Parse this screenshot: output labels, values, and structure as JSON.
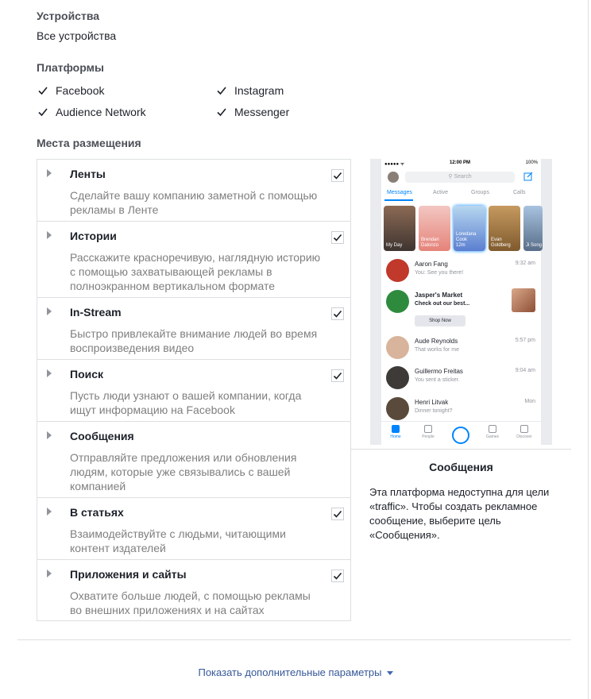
{
  "devices": {
    "title": "Устройства",
    "value": "Все устройства"
  },
  "platforms": {
    "title": "Платформы",
    "items": [
      {
        "label": "Facebook",
        "checked": true
      },
      {
        "label": "Instagram",
        "checked": true
      },
      {
        "label": "Audience Network",
        "checked": true
      },
      {
        "label": "Messenger",
        "checked": true
      }
    ]
  },
  "placements": {
    "title": "Места размещения",
    "items": [
      {
        "title": "Ленты",
        "desc": "Сделайте вашу компанию заметной с помощью рекламы в Ленте",
        "checked": true
      },
      {
        "title": "Истории",
        "desc": "Расскажите красноречивую, наглядную историю с помощью захватывающей рекламы в полноэкранном вертикальном формате",
        "checked": true
      },
      {
        "title": "In-Stream",
        "desc": "Быстро привлекайте внимание людей во время воспроизведения видео",
        "checked": true
      },
      {
        "title": "Поиск",
        "desc": "Пусть люди узнают о вашей компании, когда ищут информацию на Facebook",
        "checked": true
      },
      {
        "title": "Сообщения",
        "desc": "Отправляйте предложения или обновления людям, которые уже связывались с вашей компанией",
        "checked": false
      },
      {
        "title": "В статьях",
        "desc": "Взаимодействуйте с людьми, читающими контент издателей",
        "checked": true
      },
      {
        "title": "Приложения и сайты",
        "desc": "Охватите больше людей, с помощью рекламы во внешних приложениях и на сайтах",
        "checked": true
      }
    ]
  },
  "preview": {
    "title": "Сообщения",
    "text": "Эта платформа недоступна для цели «traffic». Чтобы создать рекламное сообщение, выберите цель «Сообщения».",
    "phone": {
      "status": {
        "signal": "●●●●● ᯤ",
        "time": "12:00 PM",
        "battery": "100%"
      },
      "search_placeholder": "Search",
      "tabs": [
        "Messages",
        "Active",
        "Groups",
        "Calls"
      ],
      "stories": [
        "My Day",
        "Brendan Dalonzo",
        "Loredana Cook",
        "Evan Goldberg",
        "Ji Song"
      ],
      "stories_sub": {
        "loredana": "12m"
      },
      "convos": [
        {
          "name": "Aaron Fang",
          "msg": "You: See you there!",
          "time": "9:32 am"
        },
        {
          "name": "Jasper's Market",
          "msg": "Check out our best...",
          "time": ""
        },
        {
          "name": "Aude Reynolds",
          "msg": "That works for me",
          "time": "5:57 pm"
        },
        {
          "name": "Guillermo Freitas",
          "msg": "You sent a sticker.",
          "time": "9:04 am"
        },
        {
          "name": "Henri Litvak",
          "msg": "Dinner tonight?",
          "time": "Mon"
        }
      ],
      "shop_now": "Shop Now",
      "nav": [
        "Home",
        "People",
        "Games",
        "Discover"
      ]
    }
  },
  "more_link": "Показать дополнительные параметры",
  "colors": {
    "link": "#365899",
    "messenger_blue": "#0084ff",
    "muted": "#7f7f7f",
    "border": "#dddfe2"
  }
}
